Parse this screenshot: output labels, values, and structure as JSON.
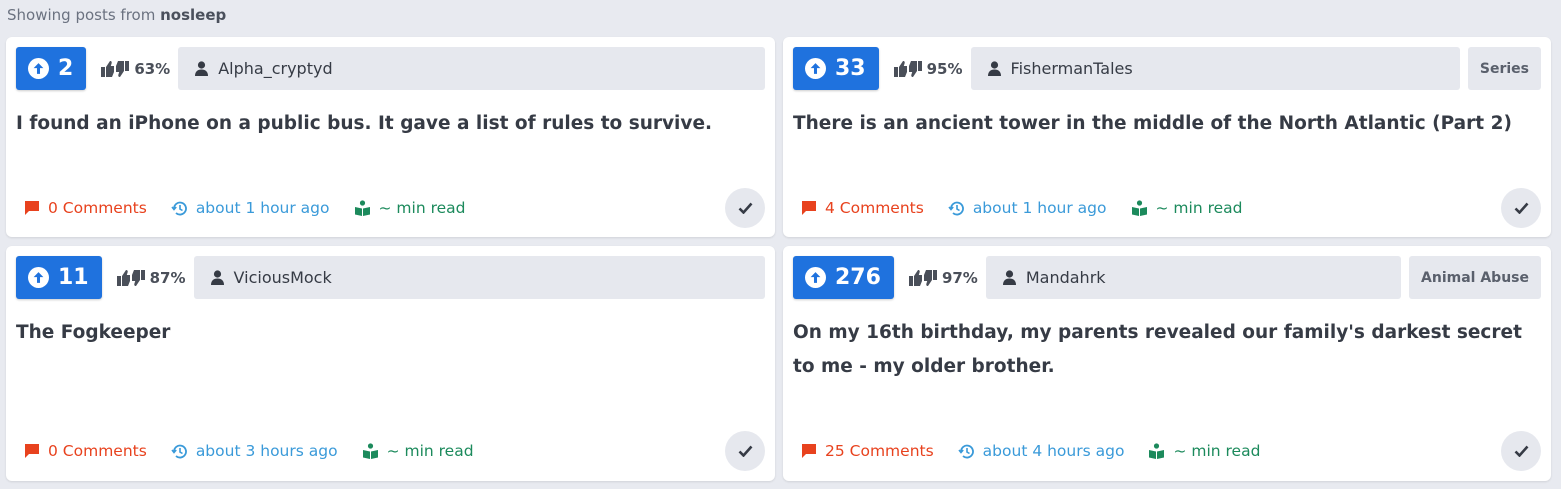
{
  "header": {
    "prefix": "Showing posts from",
    "subreddit": "nosleep"
  },
  "posts": [
    {
      "score": "2",
      "ratio": "63%",
      "author": "Alpha_cryptyd",
      "flair": "",
      "title": "I found an iPhone on a public bus. It gave a list of rules to survive.",
      "comments": "0 Comments",
      "time": "about 1 hour ago",
      "read": "~ min read"
    },
    {
      "score": "33",
      "ratio": "95%",
      "author": "FishermanTales",
      "flair": "Series",
      "title": "There is an ancient tower in the middle of the North Atlantic (Part 2)",
      "comments": "4 Comments",
      "time": "about 1 hour ago",
      "read": "~ min read"
    },
    {
      "score": "11",
      "ratio": "87%",
      "author": "ViciousMock",
      "flair": "",
      "title": "The Fogkeeper",
      "comments": "0 Comments",
      "time": "about 3 hours ago",
      "read": "~ min read"
    },
    {
      "score": "276",
      "ratio": "97%",
      "author": "Mandahrk",
      "flair": "Animal Abuse",
      "title": "On my 16th birthday, my parents revealed our family's darkest secret to me - my older brother.",
      "comments": "25 Comments",
      "time": "about 4 hours ago",
      "read": "~ min read"
    }
  ],
  "icons": {
    "upvote": "arrow-circle-up-icon",
    "ratio": "thumbs-up-down-icon",
    "author": "user-icon",
    "comments": "comment-icon",
    "time": "history-icon",
    "read": "book-reader-icon",
    "done": "check-icon"
  },
  "colors": {
    "score_bg": "#1f72de",
    "comments": "#e8421e",
    "time": "#3a9ad9",
    "read": "#1c8a5c",
    "page_bg": "#e8eaf0"
  }
}
